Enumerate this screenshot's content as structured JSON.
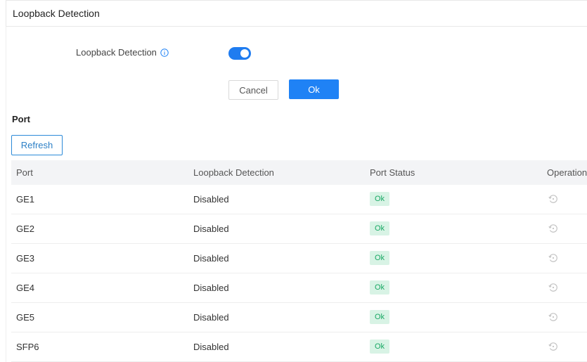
{
  "header": {
    "title": "Loopback Detection"
  },
  "form": {
    "loopback_label": "Loopback Detection",
    "loopback_enabled": true,
    "cancel_label": "Cancel",
    "ok_label": "Ok"
  },
  "port_section": {
    "title": "Port",
    "refresh_label": "Refresh",
    "columns": [
      "Port",
      "Loopback Detection",
      "Port Status",
      "Operation"
    ],
    "rows": [
      {
        "port": "GE1",
        "loopback": "Disabled",
        "status": "Ok"
      },
      {
        "port": "GE2",
        "loopback": "Disabled",
        "status": "Ok"
      },
      {
        "port": "GE3",
        "loopback": "Disabled",
        "status": "Ok"
      },
      {
        "port": "GE4",
        "loopback": "Disabled",
        "status": "Ok"
      },
      {
        "port": "GE5",
        "loopback": "Disabled",
        "status": "Ok"
      },
      {
        "port": "SFP6",
        "loopback": "Disabled",
        "status": "Ok"
      }
    ]
  },
  "colors": {
    "accent": "#1f82f5",
    "status_ok_bg": "#d8f3e5",
    "status_ok_text": "#19a864"
  },
  "icons": {
    "info": "info-icon",
    "operation": "reset-icon"
  }
}
